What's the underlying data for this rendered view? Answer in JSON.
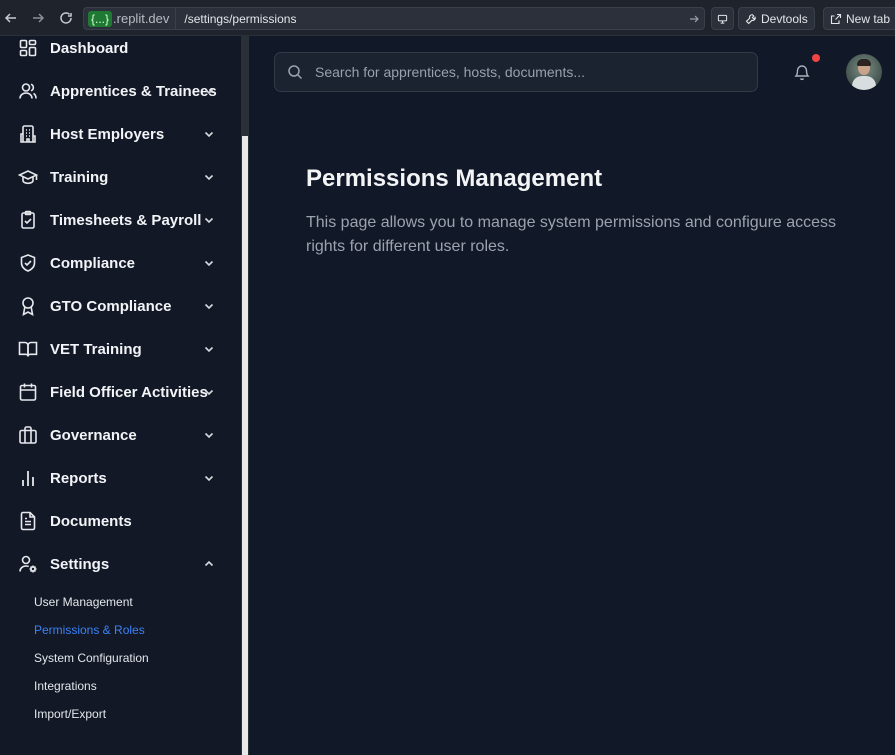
{
  "browser": {
    "url_badge": "{...}",
    "url_host": ".replit.dev",
    "url_path": "/settings/permissions",
    "devtools_label": "Devtools",
    "newtab_label": "New tab"
  },
  "sidebar": {
    "items": [
      {
        "label": "Dashboard",
        "icon": "dashboard-icon",
        "chevron": "none"
      },
      {
        "label": "Apprentices & Trainees",
        "icon": "users-icon",
        "chevron": "down"
      },
      {
        "label": "Host Employers",
        "icon": "building-icon",
        "chevron": "down"
      },
      {
        "label": "Training",
        "icon": "graduation-cap-icon",
        "chevron": "down"
      },
      {
        "label": "Timesheets & Payroll",
        "icon": "clipboard-check-icon",
        "chevron": "down"
      },
      {
        "label": "Compliance",
        "icon": "shield-check-icon",
        "chevron": "down"
      },
      {
        "label": "GTO Compliance",
        "icon": "award-icon",
        "chevron": "down"
      },
      {
        "label": "VET Training",
        "icon": "book-open-icon",
        "chevron": "down"
      },
      {
        "label": "Field Officer Activities",
        "icon": "calendar-icon",
        "chevron": "down"
      },
      {
        "label": "Governance",
        "icon": "briefcase-icon",
        "chevron": "down"
      },
      {
        "label": "Reports",
        "icon": "bar-chart-icon",
        "chevron": "down"
      },
      {
        "label": "Documents",
        "icon": "file-text-icon",
        "chevron": "none"
      },
      {
        "label": "Settings",
        "icon": "user-cog-icon",
        "chevron": "up"
      }
    ],
    "settings_sub": [
      {
        "label": "User Management",
        "active": false
      },
      {
        "label": "Permissions & Roles",
        "active": true
      },
      {
        "label": "System Configuration",
        "active": false
      },
      {
        "label": "Integrations",
        "active": false
      },
      {
        "label": "Import/Export",
        "active": false
      }
    ]
  },
  "header": {
    "search_placeholder": "Search for apprentices, hosts, documents..."
  },
  "main": {
    "title": "Permissions Management",
    "description": "This page allows you to manage system permissions and configure access rights for different user roles."
  },
  "colors": {
    "background": "#111827",
    "active_link": "#3b82f6",
    "notification_dot": "#ef4444"
  }
}
